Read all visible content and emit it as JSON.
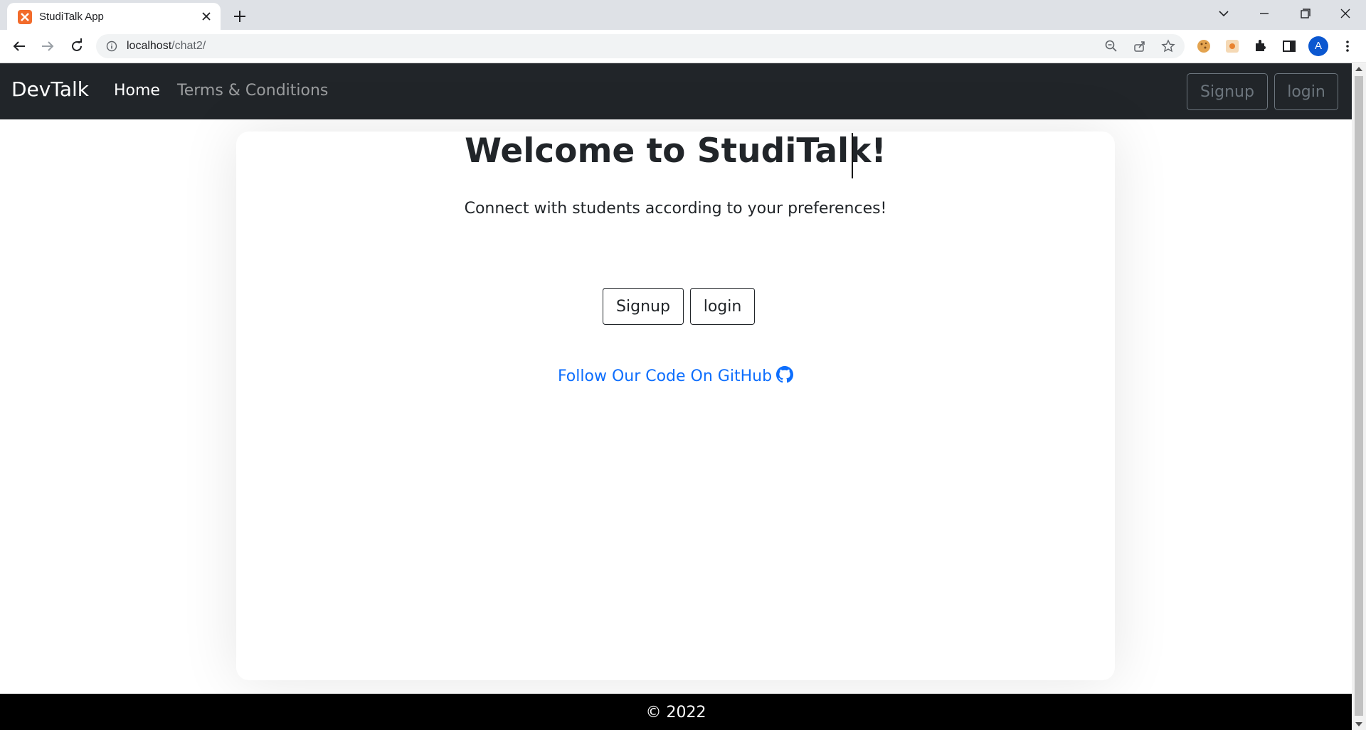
{
  "browser": {
    "tab_title": "StudiTalk App",
    "url_host": "localhost",
    "url_path": "/chat2/",
    "profile_initial": "A"
  },
  "navbar": {
    "brand": "DevTalk",
    "links": [
      "Home",
      "Terms & Conditions"
    ],
    "active_link": "Home",
    "signup_label": "Signup",
    "login_label": "login"
  },
  "hero": {
    "title": "Welcome to StudiTalk!",
    "subtitle": "Connect with students according to your preferences!",
    "signup_label": "Signup",
    "login_label": "login",
    "github_link_text": "Follow Our Code On GitHub",
    "github_icon": "github-icon"
  },
  "footer": {
    "text": "© 2022"
  },
  "colors": {
    "navbar_bg": "#212529",
    "link_blue": "#0d6efd",
    "footer_bg": "#000000",
    "favicon": "#f26b2b"
  }
}
